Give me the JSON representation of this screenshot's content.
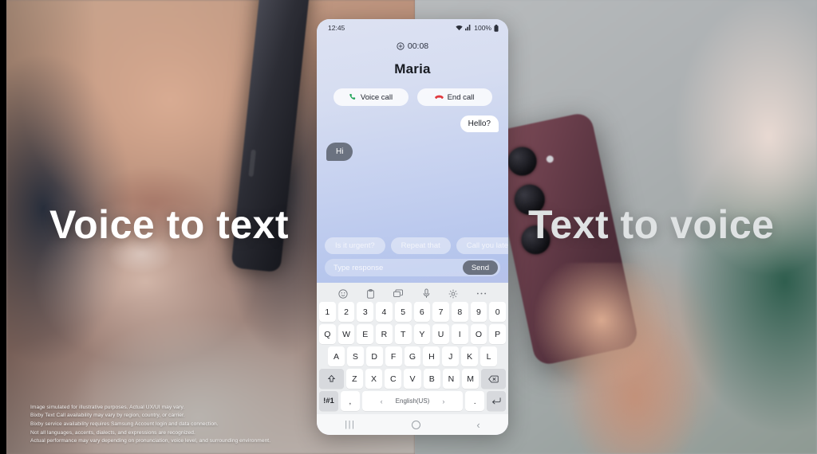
{
  "headlines": {
    "left": "Voice  to   text",
    "right": "Text to voice"
  },
  "disclaimer": {
    "line1": "Image simulated for illustrative purposes. Actual UX/UI may vary.",
    "line2": "Bixby Text Call availability may vary by region, country, or carrier.",
    "line3": "Bixby service availability requires Samsung Account login and data connection.",
    "line4": "Not all languages, accents, dialects, and expressions are recognized.",
    "line5": "Actual performance may vary depending on pronunciation, voice level, and surrounding environment."
  },
  "phone": {
    "status_bar": {
      "time": "12:45",
      "battery_percent": "100%",
      "wifi_icon": "wifi-icon",
      "signal_icon": "signal-bars-icon",
      "battery_icon": "battery-full-icon"
    },
    "call": {
      "timer": "00:08",
      "timer_icon": "bixby-text-call-icon",
      "contact_name": "Maria",
      "voice_call_label": "Voice call",
      "voice_call_icon": "phone-icon",
      "end_call_label": "End call",
      "end_call_icon": "phone-hangup-icon",
      "voice_call_color": "#23a55a",
      "end_call_color": "#e0393e"
    },
    "conversation": [
      {
        "sender": "outgoing",
        "text": "Hello?"
      },
      {
        "sender": "incoming",
        "text": "Hi"
      }
    ],
    "suggestions": [
      "Is it urgent?",
      "Repeat that",
      "Call you later"
    ],
    "composer": {
      "placeholder": "Type response",
      "value": "",
      "send_label": "Send"
    },
    "keyboard": {
      "toolbar_icons": [
        "emoji-icon",
        "clipboard-icon",
        "stickers-icon",
        "microphone-icon",
        "settings-gear-icon",
        "more-options-icon"
      ],
      "row_numbers": [
        "1",
        "2",
        "3",
        "4",
        "5",
        "6",
        "7",
        "8",
        "9",
        "0"
      ],
      "row_top": [
        "Q",
        "W",
        "E",
        "R",
        "T",
        "Y",
        "U",
        "I",
        "O",
        "P"
      ],
      "row_home": [
        "A",
        "S",
        "D",
        "F",
        "G",
        "H",
        "J",
        "K",
        "L"
      ],
      "row_bottom": [
        "Z",
        "X",
        "C",
        "V",
        "B",
        "N",
        "M"
      ],
      "shift_icon": "shift-arrow-icon",
      "backspace_icon": "backspace-icon",
      "symbols_label": "!#1",
      "comma_label": ",",
      "space_label": "English(US)",
      "space_prev_arrow": "‹",
      "space_next_arrow": "›",
      "period_label": ".",
      "enter_icon": "enter-return-icon"
    },
    "nav_bar": {
      "recents_icon": "recents-icon",
      "home_icon": "home-icon",
      "back_icon": "back-icon",
      "recents_glyph": "|||",
      "back_glyph": "‹"
    }
  }
}
